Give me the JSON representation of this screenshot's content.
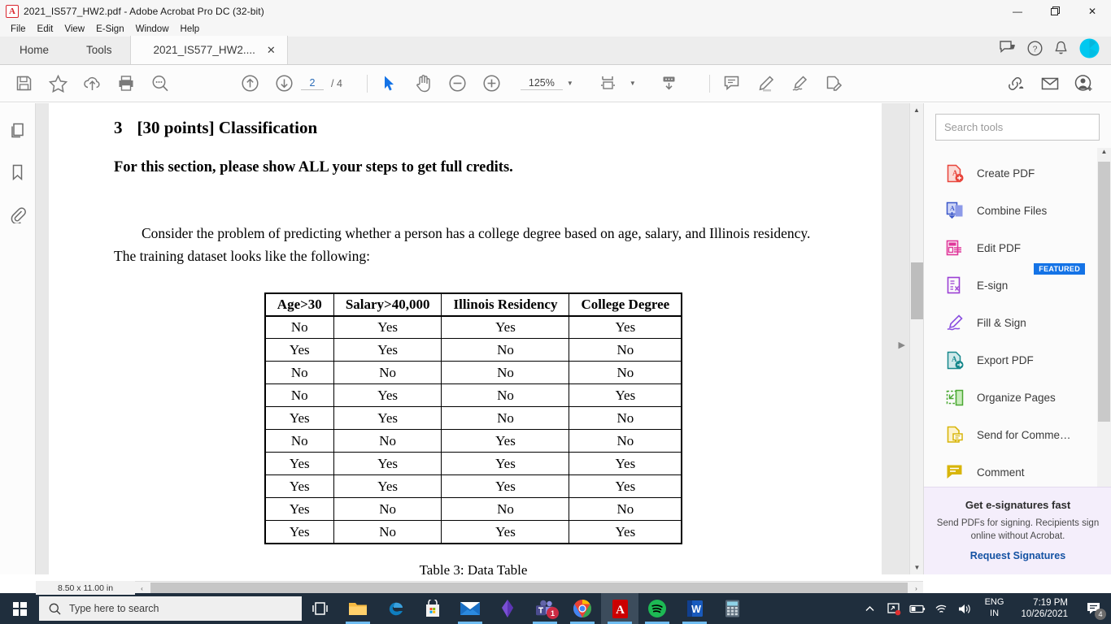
{
  "window": {
    "title": "2021_IS577_HW2.pdf - Adobe Acrobat Pro DC (32-bit)",
    "app_icon": "A",
    "minimize": "—",
    "restore": "❐",
    "close": "✕"
  },
  "menu": [
    {
      "label": "File"
    },
    {
      "label": "Edit"
    },
    {
      "label": "View"
    },
    {
      "label": "E-Sign"
    },
    {
      "label": "Window"
    },
    {
      "label": "Help"
    }
  ],
  "tabs": {
    "home": "Home",
    "tools": "Tools",
    "document": "2021_IS577_HW2....",
    "close_glyph": "✕"
  },
  "toolbar": {
    "page_current": "2",
    "page_total": "/ 4",
    "zoom_level": "125%",
    "caret": "▼",
    "icons": [
      {
        "name": "save-icon"
      },
      {
        "name": "star-icon"
      },
      {
        "name": "upload-cloud-icon"
      },
      {
        "name": "print-icon"
      },
      {
        "name": "search-icon"
      },
      {
        "name": "previous-page-icon"
      },
      {
        "name": "next-page-icon"
      },
      {
        "name": "select-tool-icon"
      },
      {
        "name": "hand-tool-icon"
      },
      {
        "name": "zoom-out-icon"
      },
      {
        "name": "zoom-in-icon"
      },
      {
        "name": "fit-page-icon"
      },
      {
        "name": "scroll-mode-icon"
      },
      {
        "name": "comment-icon"
      },
      {
        "name": "highlight-icon"
      },
      {
        "name": "draw-icon"
      },
      {
        "name": "fill-sign-icon"
      }
    ],
    "right_icons": [
      {
        "name": "share-link-icon"
      },
      {
        "name": "email-icon"
      },
      {
        "name": "add-person-icon"
      }
    ]
  },
  "header_right": {
    "feedback": "feedback-icon",
    "help": "help-icon",
    "bell": "notifications-icon",
    "avatar": "user-avatar"
  },
  "left_rail": [
    {
      "name": "page-thumbnails-icon"
    },
    {
      "name": "bookmarks-icon"
    },
    {
      "name": "attachments-icon"
    }
  ],
  "document": {
    "section_number": "3",
    "section_title": "[30 points] Classification",
    "bold_instruction": "For this section, please show ALL your steps to get full credits.",
    "paragraph": "Consider the problem of predicting whether a person has a college degree based on age, salary, and Illinois residency. The training dataset looks like the following:",
    "table": {
      "headers": [
        "Age>30",
        "Salary>40,000",
        "Illinois Residency",
        "College Degree"
      ],
      "rows": [
        [
          "No",
          "Yes",
          "Yes",
          "Yes"
        ],
        [
          "Yes",
          "Yes",
          "No",
          "No"
        ],
        [
          "No",
          "No",
          "No",
          "No"
        ],
        [
          "No",
          "Yes",
          "No",
          "Yes"
        ],
        [
          "Yes",
          "Yes",
          "No",
          "No"
        ],
        [
          "No",
          "No",
          "Yes",
          "No"
        ],
        [
          "Yes",
          "Yes",
          "Yes",
          "Yes"
        ],
        [
          "Yes",
          "Yes",
          "Yes",
          "Yes"
        ],
        [
          "Yes",
          "No",
          "No",
          "No"
        ],
        [
          "Yes",
          "No",
          "Yes",
          "Yes"
        ]
      ]
    },
    "caption": "Table 3: Data Table"
  },
  "status_bar": {
    "page_size": "8.50 x 11.00 in",
    "scroll_left": "‹",
    "scroll_right": "›"
  },
  "tools_panel": {
    "search_placeholder": "Search tools",
    "items": [
      {
        "label": "Create PDF",
        "icon": "create-pdf-icon",
        "color": "#e8443a"
      },
      {
        "label": "Combine Files",
        "icon": "combine-files-icon",
        "color": "#3a56c8"
      },
      {
        "label": "Edit PDF",
        "icon": "edit-pdf-icon",
        "color": "#e0379a"
      },
      {
        "label": "E-sign",
        "icon": "e-sign-icon",
        "color": "#9b3fd4",
        "badge": "FEATURED"
      },
      {
        "label": "Fill & Sign",
        "icon": "fill-and-sign-icon",
        "color": "#8a4fe0"
      },
      {
        "label": "Export PDF",
        "icon": "export-pdf-icon",
        "color": "#16888c"
      },
      {
        "label": "Organize Pages",
        "icon": "organize-pages-icon",
        "color": "#4aa832"
      },
      {
        "label": "Send for Comme…",
        "icon": "send-for-comments-icon",
        "color": "#d8b50a"
      },
      {
        "label": "Comment",
        "icon": "comment-tool-icon",
        "color": "#d8b50a"
      }
    ],
    "promo": {
      "title": "Get e-signatures fast",
      "body": "Send PDFs for signing. Recipients sign online without Acrobat.",
      "link": "Request Signatures"
    }
  },
  "taskbar": {
    "search_placeholder": "Type here to search",
    "apps": [
      {
        "name": "task-view-icon"
      },
      {
        "name": "file-explorer-icon"
      },
      {
        "name": "edge-icon"
      },
      {
        "name": "microsoft-store-icon"
      },
      {
        "name": "mail-icon"
      },
      {
        "name": "purple-app-icon"
      },
      {
        "name": "teams-icon",
        "badge": "1"
      },
      {
        "name": "chrome-icon"
      },
      {
        "name": "acrobat-icon",
        "active": true
      },
      {
        "name": "spotify-icon"
      },
      {
        "name": "word-icon"
      },
      {
        "name": "calculator-icon"
      }
    ],
    "tray": {
      "language_line1": "ENG",
      "language_line2": "IN",
      "time": "7:19 PM",
      "date": "10/26/2021",
      "notification_count": "4"
    }
  },
  "colors": {
    "accent_blue": "#1473e6",
    "acrobat_red": "#d9262e",
    "taskbar": "#1f2e3d",
    "promo_bg": "#f4eefb"
  }
}
